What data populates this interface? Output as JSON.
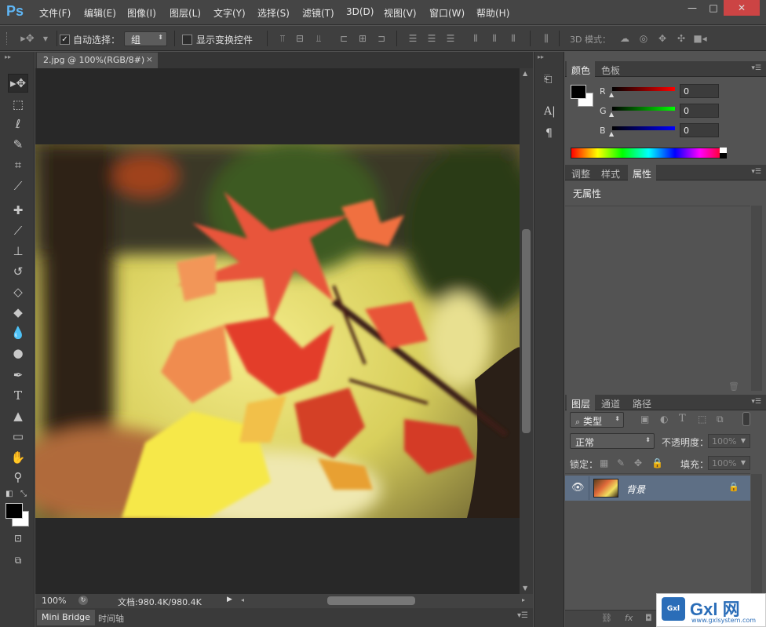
{
  "app": {
    "logo": "Ps"
  },
  "menu": [
    "文件(F)",
    "编辑(E)",
    "图像(I)",
    "图层(L)",
    "文字(Y)",
    "选择(S)",
    "滤镜(T)",
    "3D(D)",
    "视图(V)",
    "窗口(W)",
    "帮助(H)"
  ],
  "window_controls": {
    "minimize": "—",
    "maximize": "□",
    "close": "✕"
  },
  "options": {
    "auto_select_label": "自动选择：",
    "auto_select_value": "组",
    "show_transform_label": "显示变换控件",
    "mode_3d_label": "3D 模式："
  },
  "document": {
    "tab_title": "2.jpg @ 100%(RGB/8#)",
    "close": "×"
  },
  "status": {
    "zoom": "100%",
    "doc_info": "文档:980.4K/980.4K"
  },
  "bottom_tabs": [
    "Mini Bridge",
    "时间轴"
  ],
  "color_panel": {
    "tabs": [
      "颜色",
      "色板"
    ],
    "channels": [
      {
        "label": "R",
        "value": "0",
        "color": "#ff0000"
      },
      {
        "label": "G",
        "value": "0",
        "color": "#00ff00"
      },
      {
        "label": "B",
        "value": "0",
        "color": "#0000ff"
      }
    ]
  },
  "props_panel": {
    "tabs": [
      "调整",
      "样式",
      "属性"
    ],
    "content": "无属性"
  },
  "layers_panel": {
    "tabs": [
      "图层",
      "通道",
      "路径"
    ],
    "filter_label": "类型",
    "blend_mode": "正常",
    "opacity_label": "不透明度：",
    "opacity_value": "100%",
    "lock_label": "锁定：",
    "fill_label": "填充：",
    "fill_value": "100%",
    "layers": [
      {
        "name": "背景",
        "visible": true,
        "locked": true
      }
    ]
  },
  "watermark": {
    "text": "Gxl 网",
    "url": "www.gxlsystem.com"
  },
  "colors": {
    "accent_logo": "#5fb6f5",
    "layer_selected": "#5e6f85"
  }
}
